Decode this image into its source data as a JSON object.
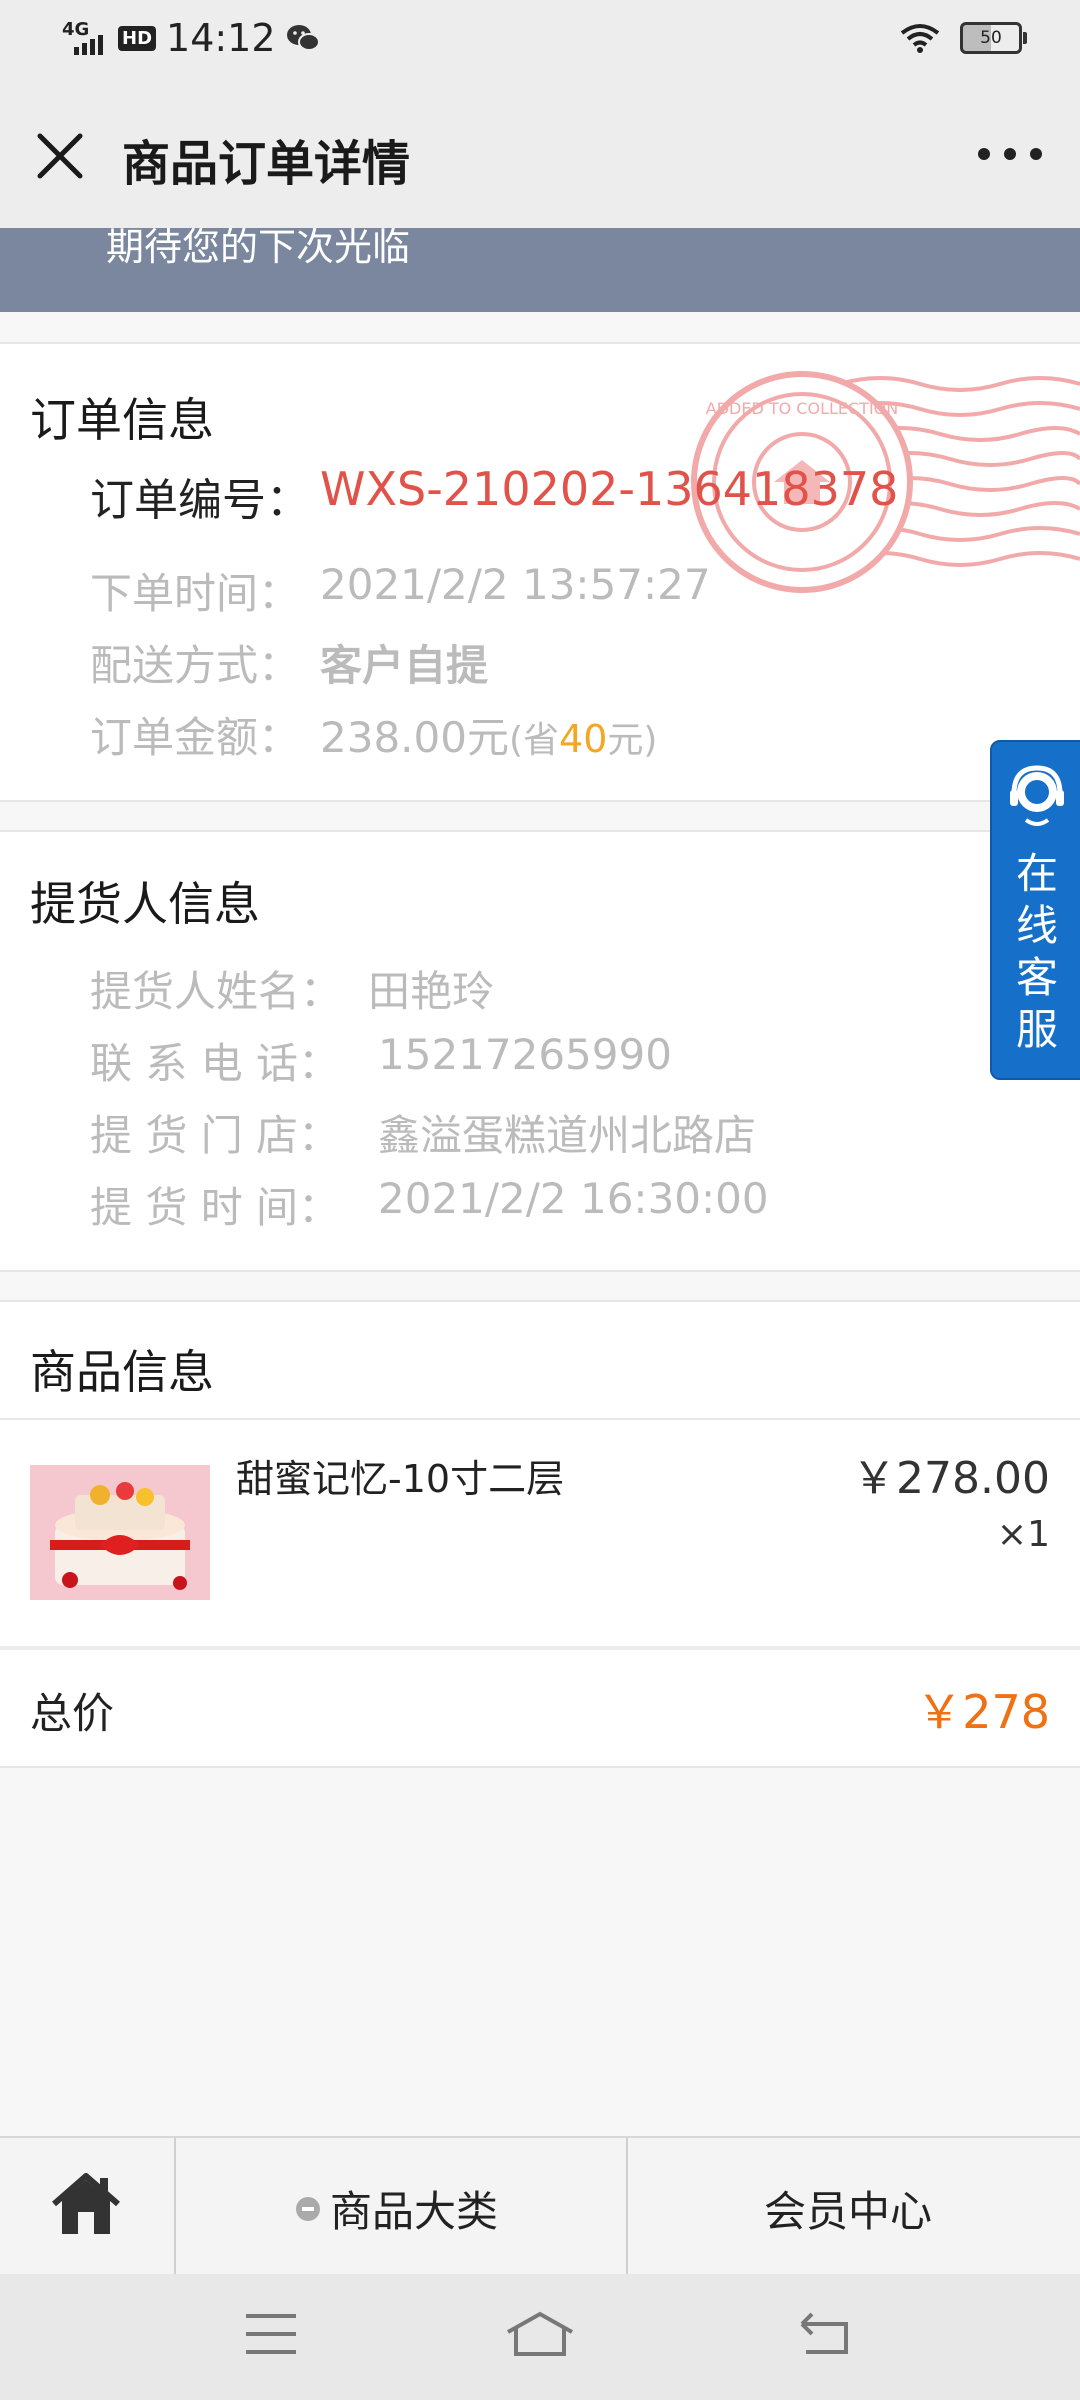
{
  "status_bar": {
    "time": "14:12",
    "network": "4G",
    "hd": "HD",
    "battery": "50"
  },
  "header": {
    "title": "商品订单详情"
  },
  "banner": {
    "text": "期待您的下次光临"
  },
  "order_info": {
    "title": "订单信息",
    "number_label": "订单编号：",
    "number_value": "WXS-210202-136418378",
    "time_label": "下单时间：",
    "time_value": "2021/2/2 13:57:27",
    "delivery_label": "配送方式：",
    "delivery_value": "客户自提",
    "amount_label": "订单金额：",
    "amount_value": "238.00元",
    "save_prefix": "(省",
    "save_amount": "40",
    "save_suffix": "元)"
  },
  "stamp": {
    "text": "ADDED TO COLLECTION"
  },
  "pickup_info": {
    "title": "提货人信息",
    "name_label": "提货人姓名：",
    "name_value": "田艳玲",
    "phone_label": "联 系 电 话：",
    "phone_value": "15217265990",
    "store_label": "提 货 门 店：",
    "store_value": "鑫溢蛋糕道州北路店",
    "time_label": "提 货 时 间：",
    "time_value": "2021/2/2 16:30:00"
  },
  "service": {
    "label": "在线客服"
  },
  "goods_info": {
    "title": "商品信息",
    "item_name": "甜蜜记忆-10寸二层",
    "item_price": "￥278.00",
    "item_qty": "×1",
    "total_label": "总价",
    "total_value": "￥278"
  },
  "bottom_nav": {
    "category": "商品大类",
    "member": "会员中心"
  },
  "colors": {
    "accent_red": "#e0524a",
    "save_orange": "#f5a623",
    "total_orange": "#f07014",
    "service_blue": "#1670c9",
    "banner": "#7a879e"
  }
}
